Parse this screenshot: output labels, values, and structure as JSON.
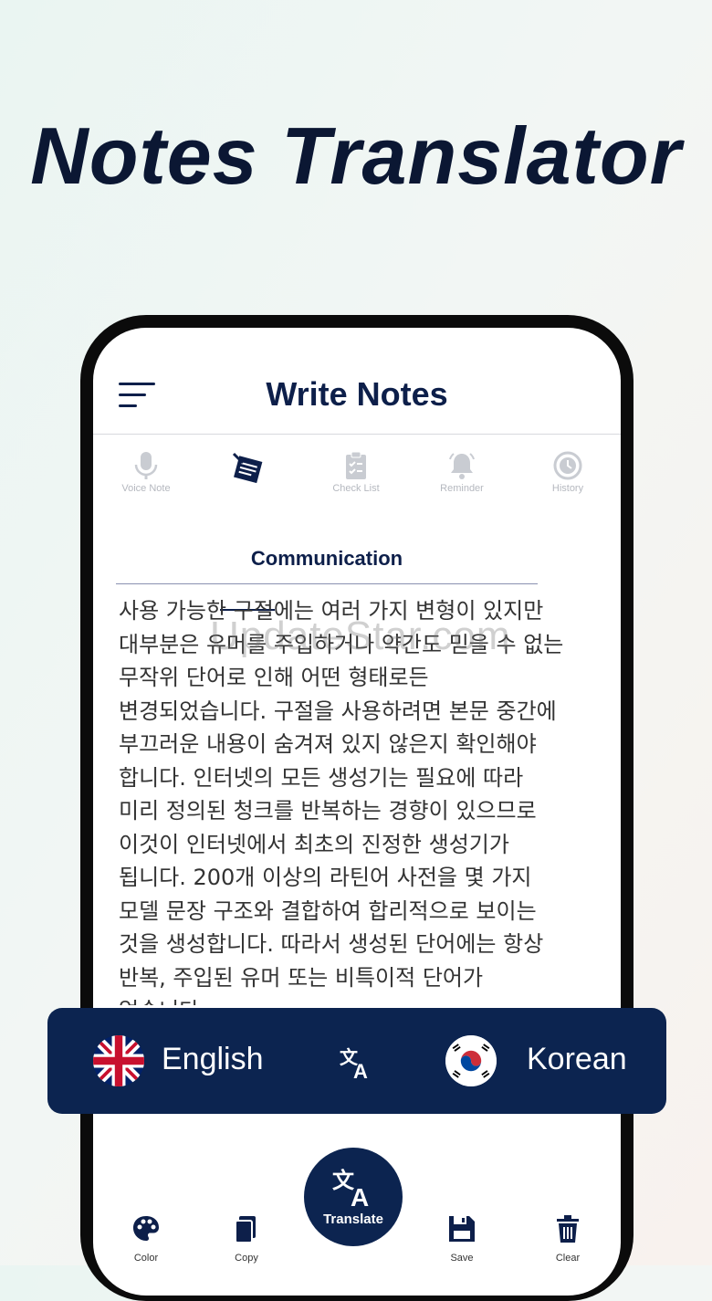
{
  "headline": "Notes Translator",
  "app": {
    "title": "Write Notes"
  },
  "tabs": [
    {
      "label": "Voice Note",
      "icon": "microphone-icon"
    },
    {
      "label": "",
      "icon": "notes-icon"
    },
    {
      "label": "Check List",
      "icon": "clipboard-icon"
    },
    {
      "label": "Reminder",
      "icon": "bell-icon"
    },
    {
      "label": "History",
      "icon": "history-icon"
    }
  ],
  "note": {
    "title": "Communication",
    "lines": [
      "사용 가능한 구절에는 여러 가지 변형이 있지만",
      "대부분은 유머를 주입하거나 약간도 믿을 수 없는",
      "무작위 단어로 인해 어떤 형태로든",
      "변경되었습니다. 구절을 사용하려면 본문 중간에",
      "부끄러운 내용이 숨겨져 있지 않은지 확인해야",
      "합니다. 인터넷의 모든 생성기는 필요에 따라",
      "미리 정의된 청크를 반복하는 경향이 있으므로",
      "이것이 인터넷에서 최초의 진정한 생성기가",
      "됩니다. 200개 이상의 라틴어 사전을 몇 가지",
      "모델 문장 구조와 결합하여 합리적으로 보이는",
      "것을 생성합니다. 따라서 생성된 단어에는 항상",
      "반복, 주입된 유머 또는 비특이적 단어가",
      "없습니다."
    ]
  },
  "watermark": "UpdateStar.com",
  "languages": {
    "source": "English",
    "target": "Korean"
  },
  "toolbar": {
    "color": "Color",
    "copy": "Copy",
    "translate": "Translate",
    "save": "Save",
    "clear": "Clear"
  },
  "colors": {
    "primary": "#0c2450",
    "text": "#0d1f4a"
  }
}
